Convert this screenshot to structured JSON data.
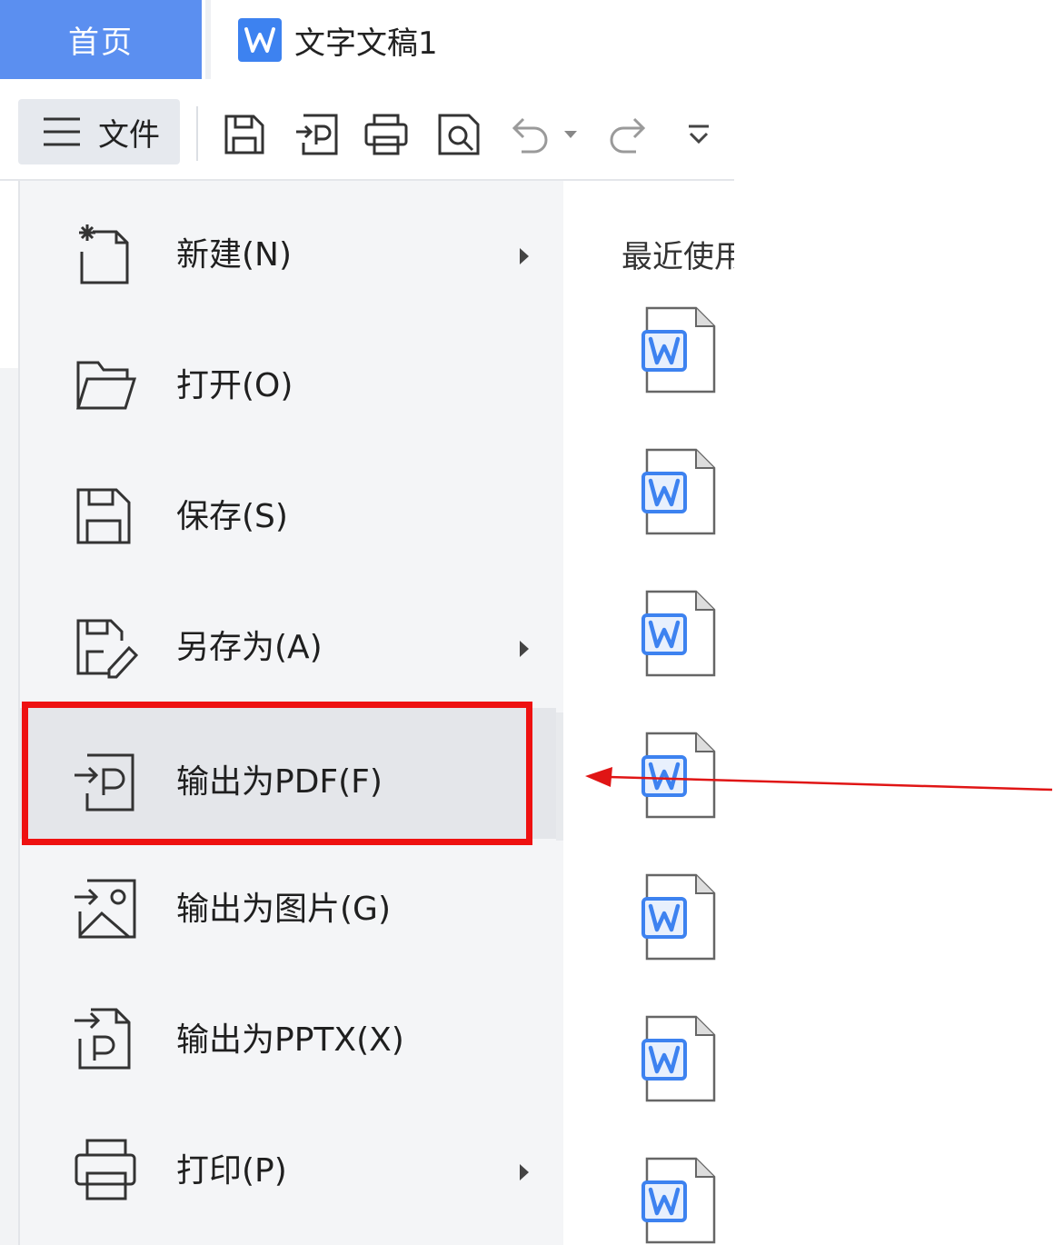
{
  "tabs": {
    "home": "首页",
    "document": "文字文稿1"
  },
  "toolbar": {
    "file_menu_label": "文件",
    "icons": [
      "save-icon",
      "export-pdf-icon",
      "print-icon",
      "print-preview-icon",
      "undo-icon",
      "undo-dropdown-icon",
      "redo-icon",
      "more-dropdown-icon"
    ]
  },
  "menu": {
    "items": [
      {
        "label": "新建(N)",
        "icon": "new-file-icon",
        "has_submenu": true
      },
      {
        "label": "打开(O)",
        "icon": "open-folder-icon",
        "has_submenu": false
      },
      {
        "label": "保存(S)",
        "icon": "save-icon",
        "has_submenu": false
      },
      {
        "label": "另存为(A)",
        "icon": "save-as-icon",
        "has_submenu": true
      },
      {
        "label": "输出为PDF(F)",
        "icon": "export-pdf-icon",
        "has_submenu": false,
        "highlighted": true
      },
      {
        "label": "输出为图片(G)",
        "icon": "export-image-icon",
        "has_submenu": false
      },
      {
        "label": "输出为PPTX(X)",
        "icon": "export-pptx-icon",
        "has_submenu": false
      },
      {
        "label": "打印(P)",
        "icon": "print-icon",
        "has_submenu": true
      }
    ]
  },
  "recent": {
    "title": "最近使用"
  },
  "colors": {
    "accent": "#5b8ff0",
    "word_blue": "#3d82f0",
    "highlight_box": "#ee1111",
    "menu_bg": "#f4f5f7"
  }
}
